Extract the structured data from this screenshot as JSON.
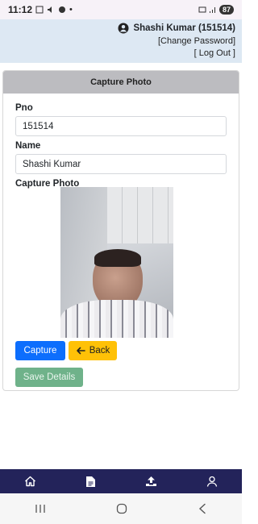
{
  "status_bar": {
    "time": "11:12",
    "battery": "87",
    "dot": "•"
  },
  "header": {
    "user_display": "Shashi Kumar (151514)",
    "change_password": "[Change Password]",
    "logout": "[ Log Out ]"
  },
  "card": {
    "title": "Capture Photo",
    "pno_label": "Pno",
    "pno_value": "151514",
    "name_label": "Name",
    "name_value": "Shashi Kumar",
    "photo_label": "Capture Photo",
    "capture_btn": "Capture",
    "back_btn": "Back",
    "save_btn": "Save Details"
  },
  "colors": {
    "primary": "#0d6efd",
    "warning": "#ffc107",
    "success_muted": "#6fb28a",
    "nav_bg": "#23235a",
    "header_bg": "#dde8f3"
  },
  "bottom_nav": {
    "items": [
      "home-icon",
      "document-icon",
      "upload-icon",
      "user-icon"
    ]
  }
}
